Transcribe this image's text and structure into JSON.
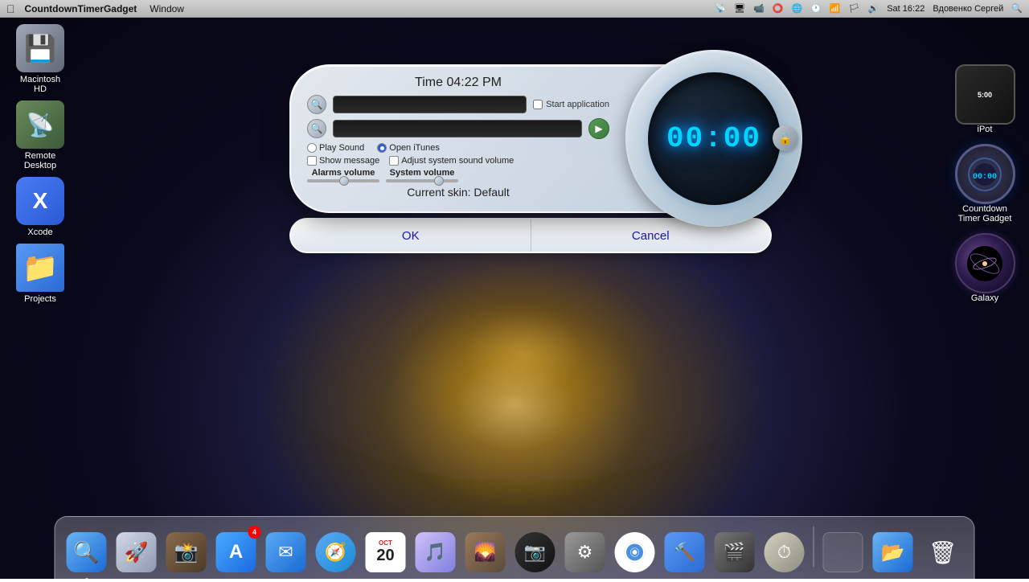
{
  "menubar": {
    "apple": "⌘",
    "app_name": "CountdownTimerGadget",
    "menus": [
      "Window"
    ],
    "time": "Sat 16:22",
    "user": "Вдовенко Сергей",
    "icons": [
      "wifi",
      "volume",
      "flag",
      "battery",
      "time",
      "search"
    ]
  },
  "dialog": {
    "time_header": "Time 04:22 PM",
    "timer_display": "00:00",
    "start_app_checkbox": false,
    "start_app_label": "Start application",
    "play_sound_label": "Play Sound",
    "open_itunes_label": "Open iTunes",
    "open_itunes_selected": true,
    "show_message_label": "Show message",
    "adjust_volume_label": "Adjust system sound volume",
    "alarms_volume_label": "Alarms volume",
    "system_volume_label": "System volume",
    "skin_label": "Current skin: Default",
    "ok_label": "OK",
    "cancel_label": "Cancel"
  },
  "right_widgets": [
    {
      "id": "ipot",
      "label": "iPot",
      "display": "5:00"
    },
    {
      "id": "countdown",
      "label": "Countdown\nTimer Gadget"
    },
    {
      "id": "galaxy",
      "label": "Galaxy"
    }
  ],
  "sidebar_items": [
    {
      "id": "macintosh-hd",
      "label": "Macintosh\nHD",
      "icon": "💾"
    },
    {
      "id": "remote-desktop",
      "label": "Remote\nDesktop",
      "icon": "🖥"
    },
    {
      "id": "xcode",
      "label": "Xcode",
      "icon": "🔨"
    },
    {
      "id": "projects",
      "label": "Projects",
      "icon": "📁"
    }
  ],
  "dock": {
    "items": [
      {
        "id": "finder",
        "icon": "🔍",
        "color": "#4a9af4",
        "label": ""
      },
      {
        "id": "launchpad",
        "icon": "🚀",
        "color": "#c0c8d8",
        "label": ""
      },
      {
        "id": "photo-booth",
        "icon": "📸",
        "color": "#8a6a4a",
        "label": ""
      },
      {
        "id": "app-store",
        "icon": "🅰",
        "color": "#4a9af4",
        "label": "",
        "badge": "4"
      },
      {
        "id": "mail",
        "icon": "✉",
        "color": "#4a9af4",
        "label": ""
      },
      {
        "id": "safari",
        "icon": "🧭",
        "color": "#4a9af4",
        "label": ""
      },
      {
        "id": "calendar",
        "icon": "📅",
        "color": "white",
        "label": "",
        "date": "20"
      },
      {
        "id": "itunes",
        "icon": "🎵",
        "color": "#e0e0ff",
        "label": ""
      },
      {
        "id": "iphoto",
        "icon": "🌄",
        "color": "#8a6a4a",
        "label": ""
      },
      {
        "id": "screenshot",
        "icon": "📷",
        "color": "#222",
        "label": ""
      },
      {
        "id": "preferences",
        "icon": "⚙",
        "color": "#888",
        "label": ""
      },
      {
        "id": "chrome",
        "icon": "◉",
        "color": "white",
        "label": ""
      },
      {
        "id": "xcode2",
        "icon": "🔧",
        "color": "#4a9af4",
        "label": ""
      },
      {
        "id": "film",
        "icon": "🎬",
        "color": "#555",
        "label": ""
      },
      {
        "id": "time-machine",
        "icon": "⏱",
        "color": "#d4d0c0",
        "label": ""
      },
      {
        "id": "blank1",
        "icon": "",
        "label": ""
      },
      {
        "id": "finder2",
        "icon": "🔍",
        "color": "#4a9af4",
        "label": ""
      },
      {
        "id": "trash",
        "icon": "🗑",
        "color": "",
        "label": ""
      }
    ]
  }
}
